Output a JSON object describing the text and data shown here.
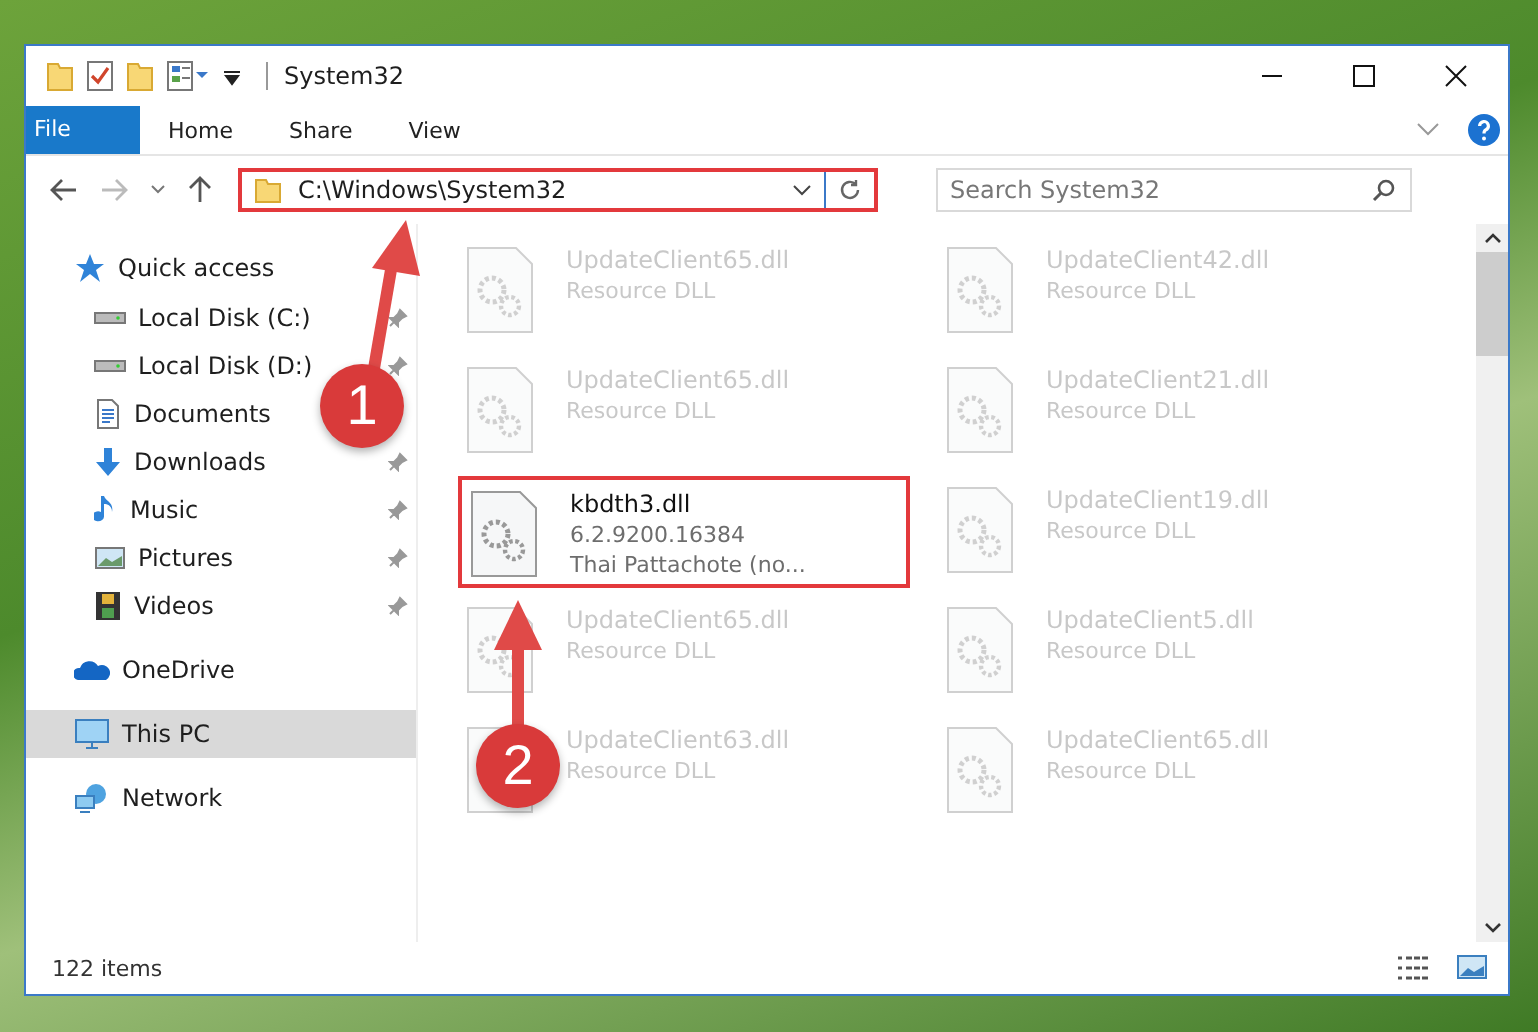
{
  "window": {
    "title": "System32"
  },
  "ribbon_tabs": [
    {
      "label": "File",
      "kind": "file-menu"
    },
    {
      "label": "Home",
      "kind": "tab"
    },
    {
      "label": "Share",
      "kind": "tab"
    },
    {
      "label": "View",
      "kind": "tab"
    }
  ],
  "address_bar": {
    "path": "C:\\Windows\\System32",
    "highlighted": true
  },
  "search": {
    "placeholder": "Search System32"
  },
  "sidebar": {
    "items": [
      {
        "label": "Quick access",
        "kind": "quick",
        "selected": false,
        "children": [
          {
            "label": "Local Disk (C:)",
            "kind": "disk",
            "pinned": true
          },
          {
            "label": "Local Disk (D:)",
            "kind": "disk",
            "pinned": true
          },
          {
            "label": "Documents",
            "kind": "documents",
            "pinned": false
          },
          {
            "label": "Downloads",
            "kind": "downloads",
            "pinned": true
          },
          {
            "label": "Music",
            "kind": "music",
            "pinned": true
          },
          {
            "label": "Pictures",
            "kind": "pictures",
            "pinned": true
          },
          {
            "label": "Videos",
            "kind": "videos",
            "pinned": true
          }
        ]
      },
      {
        "label": "OneDrive",
        "kind": "cloud",
        "selected": false
      },
      {
        "label": "This PC",
        "kind": "pc",
        "selected": true
      },
      {
        "label": "Network",
        "kind": "network",
        "selected": false
      }
    ]
  },
  "files": [
    {
      "name": "UpdateClient65.dll",
      "details": [
        "Resource DLL"
      ],
      "blurred": true,
      "highlighted": false
    },
    {
      "name": "UpdateClient42.dll",
      "details": [
        "Resource DLL"
      ],
      "blurred": true,
      "highlighted": false
    },
    {
      "name": "UpdateClient65.dll",
      "details": [
        "Resource DLL"
      ],
      "blurred": true,
      "highlighted": false
    },
    {
      "name": "UpdateClient21.dll",
      "details": [
        "Resource DLL"
      ],
      "blurred": true,
      "highlighted": false
    },
    {
      "name": "kbdth3.dll",
      "details": [
        "6.2.9200.16384",
        "Thai Pattachote (no..."
      ],
      "blurred": false,
      "highlighted": true
    },
    {
      "name": "UpdateClient19.dll",
      "details": [
        "Resource DLL"
      ],
      "blurred": true,
      "highlighted": false
    },
    {
      "name": "UpdateClient65.dll",
      "details": [
        "Resource DLL"
      ],
      "blurred": true,
      "highlighted": false
    },
    {
      "name": "UpdateClient5.dll",
      "details": [
        "Resource DLL"
      ],
      "blurred": true,
      "highlighted": false
    },
    {
      "name": "UpdateClient63.dll",
      "details": [
        "Resource DLL"
      ],
      "blurred": true,
      "highlighted": false
    },
    {
      "name": "UpdateClient65.dll",
      "details": [
        "Resource DLL"
      ],
      "blurred": true,
      "highlighted": false
    }
  ],
  "status_bar": {
    "item_count": "122 items"
  },
  "callouts": [
    {
      "label": "1"
    },
    {
      "label": "2"
    }
  ]
}
